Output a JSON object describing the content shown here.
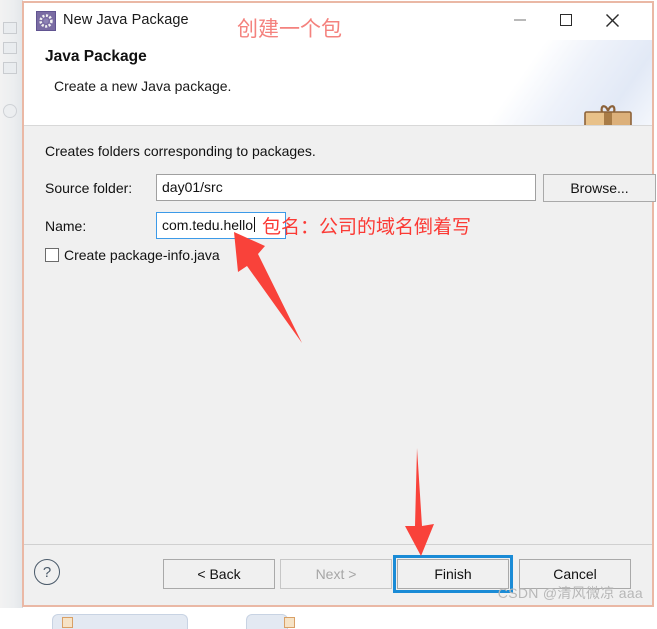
{
  "window": {
    "title": "New Java Package",
    "icon": "java-package-icon",
    "controls": {
      "minimize": "minimize-icon",
      "maximize": "maximize-icon",
      "close": "close-icon"
    }
  },
  "header": {
    "title": "Java Package",
    "description": "Create a new Java package.",
    "banner_icon": "gift-box-icon"
  },
  "form": {
    "intro": "Creates folders corresponding to packages.",
    "source_folder": {
      "label": "Source folder:",
      "value": "day01/src",
      "placeholder": ""
    },
    "browse_button": "Browse...",
    "name": {
      "label": "Name:",
      "value": "com.tedu.hello",
      "placeholder": "",
      "focused": true
    },
    "create_package_info": {
      "label": "Create package-info.java",
      "checked": false
    }
  },
  "footer": {
    "help": "?",
    "back": "< Back",
    "next": "Next >",
    "next_disabled": true,
    "finish": "Finish",
    "finish_focused": true,
    "cancel": "Cancel"
  },
  "annotations": {
    "top_note": "创建一个包",
    "name_note": "包名：公司的域名倒着写",
    "arrow_to_name": "red-arrow-icon",
    "arrow_to_finish": "red-arrow-icon"
  },
  "watermark": "CSDN @清风微凉 aaa",
  "colors": {
    "dialog_border": "#eab8a5",
    "focus_blue": "#1a8bd6",
    "annotation_red": "#fb3a35",
    "annotation_pink": "#f4827e",
    "disabled_text": "#a6a6a6"
  }
}
